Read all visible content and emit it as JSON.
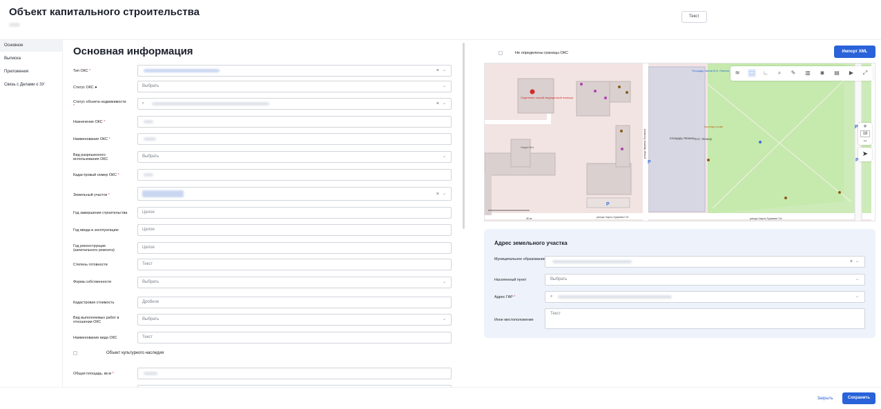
{
  "header": {
    "title": "Объект капитального строительства",
    "text_button": "Текст"
  },
  "sidebar": {
    "items": [
      {
        "label": "Основное"
      },
      {
        "label": "Выписка"
      },
      {
        "label": "Приложения"
      },
      {
        "label": "Связь с Делами о ЗУ"
      }
    ]
  },
  "form": {
    "title": "Основная информация",
    "fields": {
      "type": {
        "label": "Тип ОКС"
      },
      "status": {
        "label": "Статус ОКС",
        "value": "Выбрать"
      },
      "realty_status": {
        "label": "Статус объекта недвижимости"
      },
      "purpose": {
        "label": "Назначение ОКС"
      },
      "name": {
        "label": "Наименование ОКС"
      },
      "permitted_use": {
        "label": "Вид разрешенного использования ОКС",
        "value": "Выбрать"
      },
      "cadastral_number": {
        "label": "Кадастровый номер ОКС"
      },
      "land_plot": {
        "label": "Земельный участок"
      },
      "build_year": {
        "label": "Год завершения строительства",
        "placeholder": "Целое"
      },
      "commission_year": {
        "label": "Год ввода в эксплуатацию",
        "placeholder": "Целое"
      },
      "reconstruction_year": {
        "label": "Год реконструкции (капитального ремонта)",
        "placeholder": "Целое"
      },
      "readiness": {
        "label": "Степень готовности",
        "placeholder": "Текст"
      },
      "ownership": {
        "label": "Форма собственности",
        "value": "Выбрать"
      },
      "cadastral_value": {
        "label": "Кадастровая стоимость",
        "placeholder": "Дробное"
      },
      "works_type": {
        "label": "Вид выполняемых работ в отношении ОКС",
        "value": "Выбрать"
      },
      "kind_name": {
        "label": "Наименование вида ОКС",
        "placeholder": "Текст"
      },
      "heritage": {
        "label": "Объект культурного наследия"
      },
      "total_area": {
        "label": "Общая площадь, кв.м"
      }
    }
  },
  "map": {
    "no_borders_label": "Не определены границы ОКС",
    "import_label": "Импорт XML",
    "zoom_level": "18",
    "labels": {
      "square": "площадь Ленина",
      "street": "улица Чорос-Гуркина Г.И.",
      "street2": "улица Чорос-Гуркина Г.И.",
      "lane": "улица Эрмека Палкина",
      "scale": "30 м",
      "hospital": "Отделение скорой медицинской помощи",
      "lyceum": "Лицей №1",
      "monument": "В.И. Ленину",
      "cafe": "Культура кофе",
      "lib": "Площадь имени В.И. Ленина"
    }
  },
  "address": {
    "title": "Адрес земельного участка",
    "municipality": {
      "label": "Муниципальное образование"
    },
    "settlement": {
      "label": "Населенный пункт",
      "value": "Выбрать"
    },
    "gar": {
      "label": "Адрес ГАР"
    },
    "other": {
      "label": "Иное местоположение",
      "placeholder": "Текст"
    }
  },
  "footer": {
    "close_label": "Закрыть",
    "save_label": "Сохранить"
  },
  "colors": {
    "accent": "#2962d9",
    "required": "#e0353b"
  }
}
